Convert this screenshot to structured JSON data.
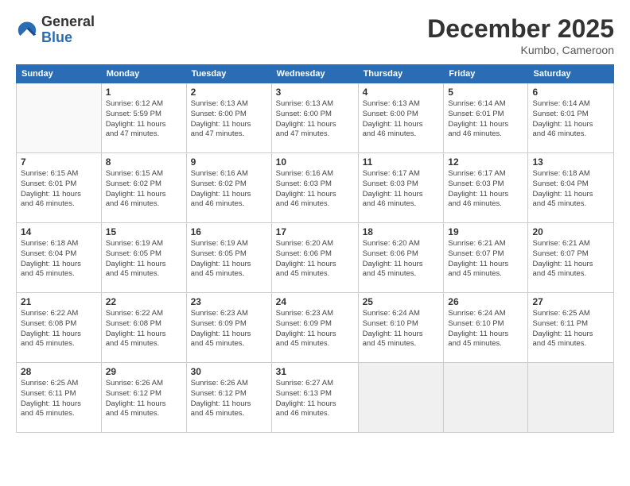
{
  "logo": {
    "general": "General",
    "blue": "Blue"
  },
  "header": {
    "month": "December 2025",
    "location": "Kumbo, Cameroon"
  },
  "weekdays": [
    "Sunday",
    "Monday",
    "Tuesday",
    "Wednesday",
    "Thursday",
    "Friday",
    "Saturday"
  ],
  "weeks": [
    [
      {
        "day": "",
        "info": ""
      },
      {
        "day": "1",
        "info": "Sunrise: 6:12 AM\nSunset: 5:59 PM\nDaylight: 11 hours\nand 47 minutes."
      },
      {
        "day": "2",
        "info": "Sunrise: 6:13 AM\nSunset: 6:00 PM\nDaylight: 11 hours\nand 47 minutes."
      },
      {
        "day": "3",
        "info": "Sunrise: 6:13 AM\nSunset: 6:00 PM\nDaylight: 11 hours\nand 47 minutes."
      },
      {
        "day": "4",
        "info": "Sunrise: 6:13 AM\nSunset: 6:00 PM\nDaylight: 11 hours\nand 46 minutes."
      },
      {
        "day": "5",
        "info": "Sunrise: 6:14 AM\nSunset: 6:01 PM\nDaylight: 11 hours\nand 46 minutes."
      },
      {
        "day": "6",
        "info": "Sunrise: 6:14 AM\nSunset: 6:01 PM\nDaylight: 11 hours\nand 46 minutes."
      }
    ],
    [
      {
        "day": "7",
        "info": "Sunrise: 6:15 AM\nSunset: 6:01 PM\nDaylight: 11 hours\nand 46 minutes."
      },
      {
        "day": "8",
        "info": "Sunrise: 6:15 AM\nSunset: 6:02 PM\nDaylight: 11 hours\nand 46 minutes."
      },
      {
        "day": "9",
        "info": "Sunrise: 6:16 AM\nSunset: 6:02 PM\nDaylight: 11 hours\nand 46 minutes."
      },
      {
        "day": "10",
        "info": "Sunrise: 6:16 AM\nSunset: 6:03 PM\nDaylight: 11 hours\nand 46 minutes."
      },
      {
        "day": "11",
        "info": "Sunrise: 6:17 AM\nSunset: 6:03 PM\nDaylight: 11 hours\nand 46 minutes."
      },
      {
        "day": "12",
        "info": "Sunrise: 6:17 AM\nSunset: 6:03 PM\nDaylight: 11 hours\nand 46 minutes."
      },
      {
        "day": "13",
        "info": "Sunrise: 6:18 AM\nSunset: 6:04 PM\nDaylight: 11 hours\nand 45 minutes."
      }
    ],
    [
      {
        "day": "14",
        "info": "Sunrise: 6:18 AM\nSunset: 6:04 PM\nDaylight: 11 hours\nand 45 minutes."
      },
      {
        "day": "15",
        "info": "Sunrise: 6:19 AM\nSunset: 6:05 PM\nDaylight: 11 hours\nand 45 minutes."
      },
      {
        "day": "16",
        "info": "Sunrise: 6:19 AM\nSunset: 6:05 PM\nDaylight: 11 hours\nand 45 minutes."
      },
      {
        "day": "17",
        "info": "Sunrise: 6:20 AM\nSunset: 6:06 PM\nDaylight: 11 hours\nand 45 minutes."
      },
      {
        "day": "18",
        "info": "Sunrise: 6:20 AM\nSunset: 6:06 PM\nDaylight: 11 hours\nand 45 minutes."
      },
      {
        "day": "19",
        "info": "Sunrise: 6:21 AM\nSunset: 6:07 PM\nDaylight: 11 hours\nand 45 minutes."
      },
      {
        "day": "20",
        "info": "Sunrise: 6:21 AM\nSunset: 6:07 PM\nDaylight: 11 hours\nand 45 minutes."
      }
    ],
    [
      {
        "day": "21",
        "info": "Sunrise: 6:22 AM\nSunset: 6:08 PM\nDaylight: 11 hours\nand 45 minutes."
      },
      {
        "day": "22",
        "info": "Sunrise: 6:22 AM\nSunset: 6:08 PM\nDaylight: 11 hours\nand 45 minutes."
      },
      {
        "day": "23",
        "info": "Sunrise: 6:23 AM\nSunset: 6:09 PM\nDaylight: 11 hours\nand 45 minutes."
      },
      {
        "day": "24",
        "info": "Sunrise: 6:23 AM\nSunset: 6:09 PM\nDaylight: 11 hours\nand 45 minutes."
      },
      {
        "day": "25",
        "info": "Sunrise: 6:24 AM\nSunset: 6:10 PM\nDaylight: 11 hours\nand 45 minutes."
      },
      {
        "day": "26",
        "info": "Sunrise: 6:24 AM\nSunset: 6:10 PM\nDaylight: 11 hours\nand 45 minutes."
      },
      {
        "day": "27",
        "info": "Sunrise: 6:25 AM\nSunset: 6:11 PM\nDaylight: 11 hours\nand 45 minutes."
      }
    ],
    [
      {
        "day": "28",
        "info": "Sunrise: 6:25 AM\nSunset: 6:11 PM\nDaylight: 11 hours\nand 45 minutes."
      },
      {
        "day": "29",
        "info": "Sunrise: 6:26 AM\nSunset: 6:12 PM\nDaylight: 11 hours\nand 45 minutes."
      },
      {
        "day": "30",
        "info": "Sunrise: 6:26 AM\nSunset: 6:12 PM\nDaylight: 11 hours\nand 45 minutes."
      },
      {
        "day": "31",
        "info": "Sunrise: 6:27 AM\nSunset: 6:13 PM\nDaylight: 11 hours\nand 46 minutes."
      },
      {
        "day": "",
        "info": ""
      },
      {
        "day": "",
        "info": ""
      },
      {
        "day": "",
        "info": ""
      }
    ]
  ]
}
